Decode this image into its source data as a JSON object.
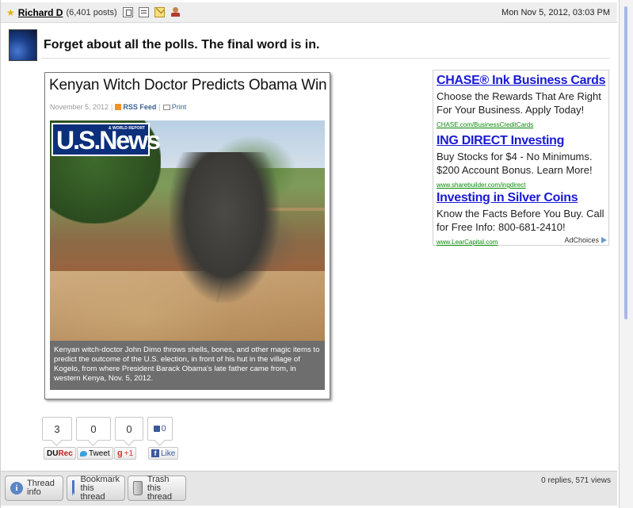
{
  "post": {
    "author": "Richard D",
    "post_count": "(6,401 posts)",
    "date": "Mon Nov 5, 2012, 03:03 PM",
    "title": "Forget about all the polls. The final word is in."
  },
  "article": {
    "headline": "Kenyan Witch Doctor Predicts Obama Win",
    "date": "November 5, 2012",
    "rss_label": "RSS Feed",
    "print_label": "Print",
    "logo_text": "U.S.News",
    "logo_subtext": "& WORLD REPORT",
    "caption": "Kenyan witch-doctor John Dimo throws shells, bones, and other magic items to predict the outcome of the U.S. election, in front of his hut in the village of Kogelo, from where President Barack Obama's late father came from, in western Kenya, Nov. 5, 2012."
  },
  "ads": [
    {
      "title": "CHASE® Ink Business Cards",
      "body": "Choose the Rewards That Are Right For Your Business. Apply Today!",
      "url": "CHASE.com/BusinessCreditCards"
    },
    {
      "title": "ING DIRECT Investing",
      "body": "Buy Stocks for $4 - No Minimums. $200 Account Bonus. Learn More!",
      "url": "www.sharebuilder.com/ingdirect"
    },
    {
      "title": "Investing in Silver Coins",
      "body": "Know the Facts Before You Buy. Call for Free Info: 800-681-2410!",
      "url": "www.LearCapital.com"
    }
  ],
  "adchoices_label": "AdChoices",
  "share": {
    "du_count": "3",
    "du_label_1": "DU",
    "du_label_2": "Rec",
    "tweet_count": "0",
    "tweet_label": "Tweet",
    "gplus_count": "0",
    "gplus_label": "+1",
    "fb_count": "0",
    "fb_label": "Like"
  },
  "footer": {
    "thread_info": "Thread\ninfo",
    "bookmark": "Bookmark\nthis thread",
    "trash": "Trash\nthis thread",
    "stats": "0 replies, 571 views"
  }
}
